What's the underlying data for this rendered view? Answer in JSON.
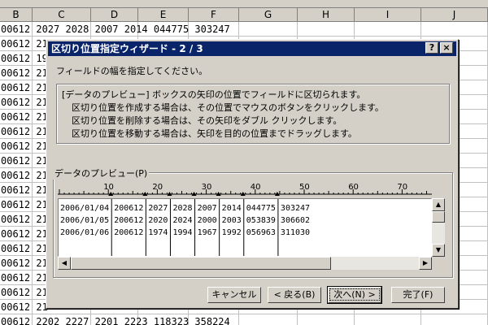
{
  "spreadsheet": {
    "columns": [
      "B",
      "C",
      "D",
      "E",
      "F",
      "G",
      "H",
      "I",
      "J"
    ],
    "row_texts": [
      "00612 2027 2028 2007 2014 044775 303247",
      "00612 21",
      "00612 19",
      "00612 21",
      "00612 21",
      "00612 21",
      "00612 21",
      "00612 21",
      "00612 21",
      "00612 21",
      "00612 21",
      "00612 21",
      "00612 21",
      "00612 21",
      "00612 21",
      "00612 21",
      "00612 21",
      "00612 21",
      "00612 21",
      "00612 21",
      "00612 2202 2227 2201 2223 118323 358224"
    ]
  },
  "dialog": {
    "title": "区切り位置指定ウィザード - 2 / 3",
    "help_label": "?",
    "close_label": "×",
    "instruction": "フィールドの幅を指定してください。",
    "info_lines": [
      "[データのプレビュー] ボックスの矢印の位置でフィールドに区切られます。",
      "区切り位置を作成する場合は、その位置でマウスのボタンをクリックします。",
      "区切り位置を削除する場合は、その矢印をダブル クリックします。",
      "区切り位置を移動する場合は、矢印を目的の位置までドラッグします。"
    ],
    "preview_label": "データのプレビュー(P)",
    "ruler_numbers": [
      "10",
      "20",
      "30",
      "40",
      "50",
      "60",
      "70"
    ],
    "break_positions": [
      11,
      18,
      23,
      28,
      33,
      38,
      45
    ],
    "preview_rows": [
      "2006/01/04 200612 2027 2028 2007 2014 044775 303247",
      "2006/01/05 200612 2020 2024 2000 2003 053839 306602",
      "2006/01/06 200612 1974 1994 1967 1992 056963 311030"
    ],
    "buttons": {
      "cancel": "キャンセル",
      "back": "< 戻る(B)",
      "next": "次へ(N) >",
      "finish": "完了(F)"
    }
  },
  "colors": {
    "titlebar": "#0a246a",
    "face": "#d4d0c8"
  }
}
